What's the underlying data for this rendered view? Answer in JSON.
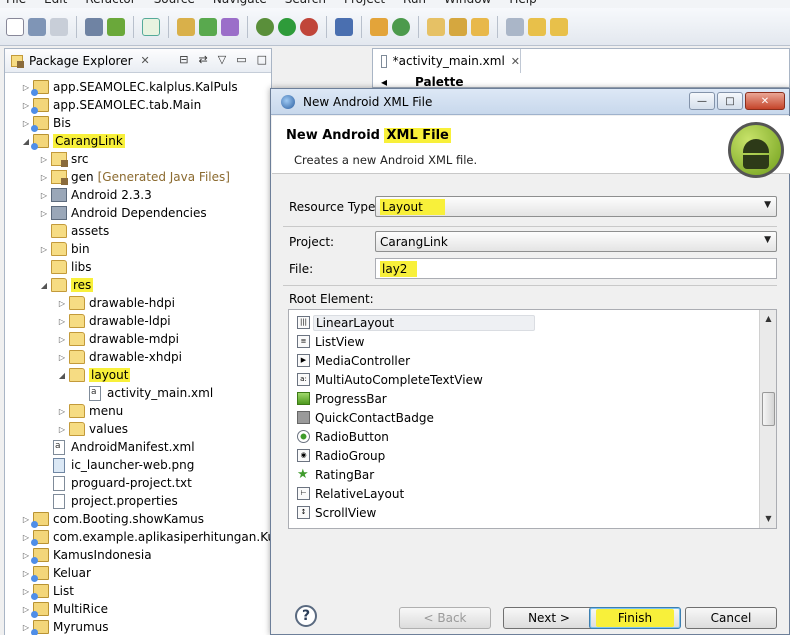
{
  "menu": [
    "File",
    "Edit",
    "Refactor",
    "Source",
    "Navigate",
    "Search",
    "Project",
    "Run",
    "Window",
    "Help"
  ],
  "package_explorer": {
    "title": "Package Explorer",
    "tree": [
      {
        "label": "app.SEAMOLEC.kalplus.KalPuls",
        "type": "proj",
        "depth": 0,
        "arrow": "▷"
      },
      {
        "label": "app.SEAMOLEC.tab.Main",
        "type": "proj",
        "depth": 0,
        "arrow": "▷"
      },
      {
        "label": "Bis",
        "type": "proj",
        "depth": 0,
        "arrow": "▷"
      },
      {
        "label": "CarangLink",
        "type": "proj",
        "depth": 0,
        "arrow": "◢",
        "highlight": true
      },
      {
        "label": "src",
        "type": "pkgfolder",
        "depth": 1,
        "arrow": "▷"
      },
      {
        "label": "gen",
        "extra": "[Generated Java Files]",
        "type": "pkgfolder",
        "depth": 1,
        "arrow": "▷"
      },
      {
        "label": "Android 2.3.3",
        "type": "lib",
        "depth": 1,
        "arrow": "▷"
      },
      {
        "label": "Android Dependencies",
        "type": "lib",
        "depth": 1,
        "arrow": "▷"
      },
      {
        "label": "assets",
        "type": "folder",
        "depth": 1,
        "arrow": ""
      },
      {
        "label": "bin",
        "type": "folder",
        "depth": 1,
        "arrow": "▷"
      },
      {
        "label": "libs",
        "type": "folder",
        "depth": 1,
        "arrow": ""
      },
      {
        "label": "res",
        "type": "folder",
        "depth": 1,
        "arrow": "◢",
        "highlight": true
      },
      {
        "label": "drawable-hdpi",
        "type": "folder",
        "depth": 2,
        "arrow": "▷"
      },
      {
        "label": "drawable-ldpi",
        "type": "folder",
        "depth": 2,
        "arrow": "▷"
      },
      {
        "label": "drawable-mdpi",
        "type": "folder",
        "depth": 2,
        "arrow": "▷"
      },
      {
        "label": "drawable-xhdpi",
        "type": "folder",
        "depth": 2,
        "arrow": "▷"
      },
      {
        "label": "layout",
        "type": "folder",
        "depth": 2,
        "arrow": "◢",
        "highlight": true
      },
      {
        "label": "activity_main.xml",
        "type": "xml",
        "depth": 3,
        "arrow": ""
      },
      {
        "label": "menu",
        "type": "folder",
        "depth": 2,
        "arrow": "▷"
      },
      {
        "label": "values",
        "type": "folder",
        "depth": 2,
        "arrow": "▷"
      },
      {
        "label": "AndroidManifest.xml",
        "type": "xml",
        "depth": 1,
        "arrow": ""
      },
      {
        "label": "ic_launcher-web.png",
        "type": "img",
        "depth": 1,
        "arrow": ""
      },
      {
        "label": "proguard-project.txt",
        "type": "file",
        "depth": 1,
        "arrow": ""
      },
      {
        "label": "project.properties",
        "type": "file",
        "depth": 1,
        "arrow": ""
      },
      {
        "label": "com.Booting.showKamus",
        "type": "proj",
        "depth": 0,
        "arrow": "▷"
      },
      {
        "label": "com.example.aplikasiperhitungan.Kubus",
        "type": "proj",
        "depth": 0,
        "arrow": "▷"
      },
      {
        "label": "KamusIndonesia",
        "type": "proj",
        "depth": 0,
        "arrow": "▷"
      },
      {
        "label": "Keluar",
        "type": "proj",
        "depth": 0,
        "arrow": "▷"
      },
      {
        "label": "List",
        "type": "proj",
        "depth": 0,
        "arrow": "▷"
      },
      {
        "label": "MultiRice",
        "type": "proj",
        "depth": 0,
        "arrow": "▷"
      },
      {
        "label": "Myrumus",
        "type": "proj",
        "depth": 0,
        "arrow": "▷"
      }
    ]
  },
  "editor": {
    "tab_label": "*activity_main.xml",
    "palette_label": "Palette"
  },
  "dialog": {
    "title": "New Android XML File",
    "banner_title_prefix": "New Android ",
    "banner_title_highlight": "XML File",
    "banner_desc": "Creates a new Android XML file.",
    "resource_type_label": "Resource Type:",
    "resource_type_value": "Layout",
    "project_label": "Project:",
    "project_value": "CarangLink",
    "file_label": "File:",
    "file_value": "lay2",
    "root_element_label": "Root Element:",
    "root_elements": [
      {
        "label": "LinearLayout",
        "icon": "linear",
        "selected": true
      },
      {
        "label": "ListView",
        "icon": "list"
      },
      {
        "label": "MediaController",
        "icon": "media"
      },
      {
        "label": "MultiAutoCompleteTextView",
        "icon": "autocomplete"
      },
      {
        "label": "ProgressBar",
        "icon": "progress"
      },
      {
        "label": "QuickContactBadge",
        "icon": "badge"
      },
      {
        "label": "RadioButton",
        "icon": "radio"
      },
      {
        "label": "RadioGroup",
        "icon": "radiogroup"
      },
      {
        "label": "RatingBar",
        "icon": "star"
      },
      {
        "label": "RelativeLayout",
        "icon": "relative"
      },
      {
        "label": "ScrollView",
        "icon": "scroll"
      }
    ],
    "buttons": {
      "back": "< Back",
      "next": "Next >",
      "finish": "Finish",
      "cancel": "Cancel"
    }
  },
  "colors": {
    "highlight": "#f8f03a",
    "dialog_title_bar": "#c8d8ec",
    "close_button": "#c5442a"
  }
}
